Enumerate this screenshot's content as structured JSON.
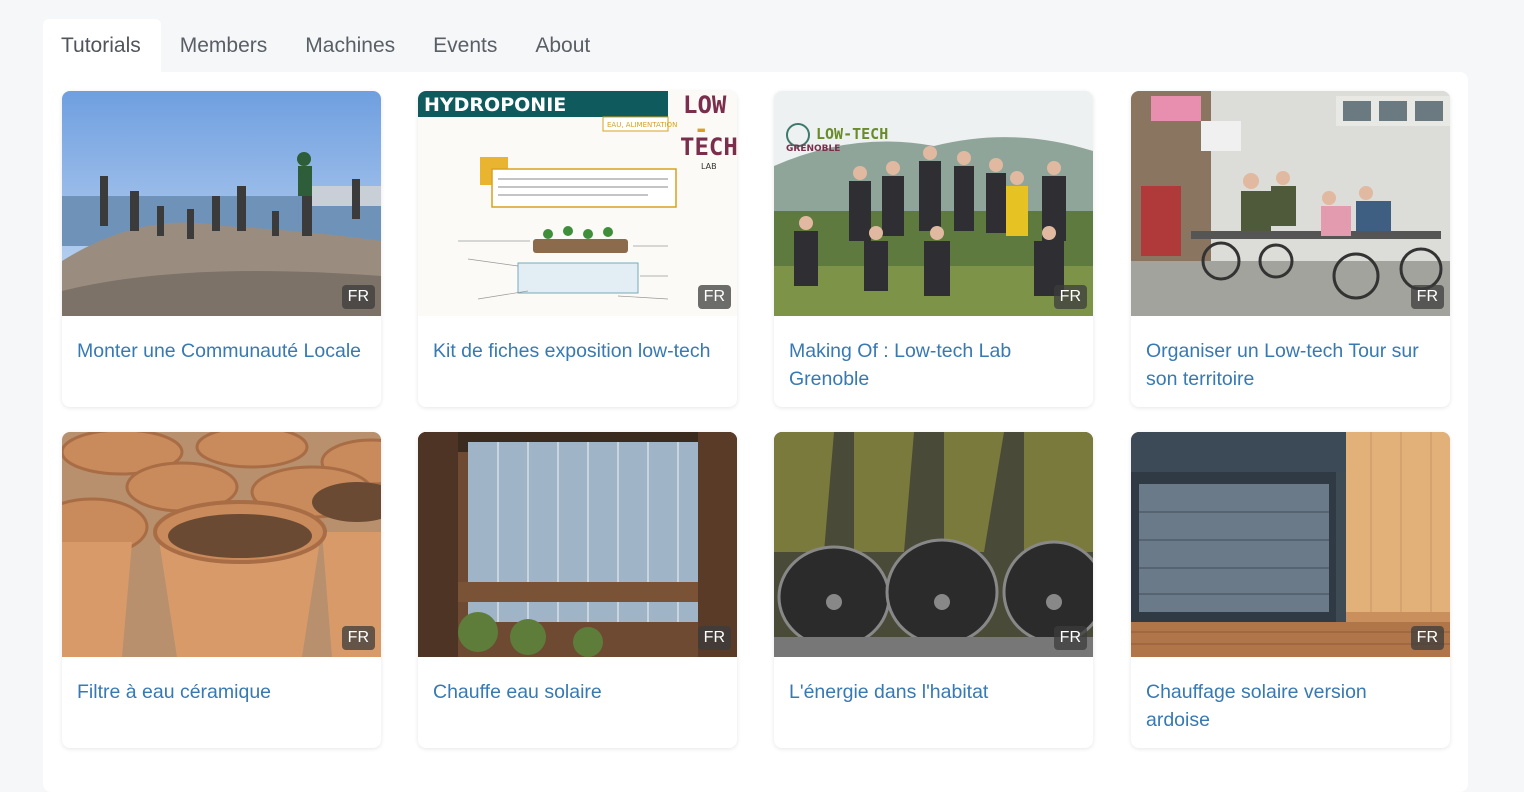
{
  "tabs": [
    {
      "label": "Tutorials",
      "active": true
    },
    {
      "label": "Members"
    },
    {
      "label": "Machines"
    },
    {
      "label": "Events"
    },
    {
      "label": "About"
    }
  ],
  "cards": [
    {
      "title": "Monter une Communauté Locale",
      "lang": "FR",
      "image": "group-jumping-coast-photo"
    },
    {
      "title": "Kit de fiches exposition low-tech",
      "lang": "FR",
      "image": "hydroponie-poster-image",
      "image_text": {
        "heading": "HYDROPONIE",
        "tag": "EAU, ALIMENTATION",
        "logo": [
          "LOW",
          "-",
          "TECH",
          "LAB"
        ]
      }
    },
    {
      "title": "Making Of : Low-tech Lab Grenoble",
      "lang": "FR",
      "image": "team-photo-image",
      "image_text": {
        "logo": "LOW-TECH",
        "logo_sub": "GRENOBLE"
      }
    },
    {
      "title": "Organiser un Low-tech Tour sur son territoire",
      "lang": "FR",
      "image": "velomobile-ride-photo"
    },
    {
      "title": "Filtre à eau céramique",
      "lang": "FR",
      "image": "ceramic-pots-photo"
    },
    {
      "title": "Chauffe eau solaire",
      "lang": "FR",
      "image": "solar-panel-wall-photo"
    },
    {
      "title": "L'énergie dans l'habitat",
      "lang": "FR",
      "image": "vacuum-tubes-photo"
    },
    {
      "title": "Chauffage solaire version ardoise",
      "lang": "FR",
      "image": "slate-solar-heater-photo"
    }
  ]
}
